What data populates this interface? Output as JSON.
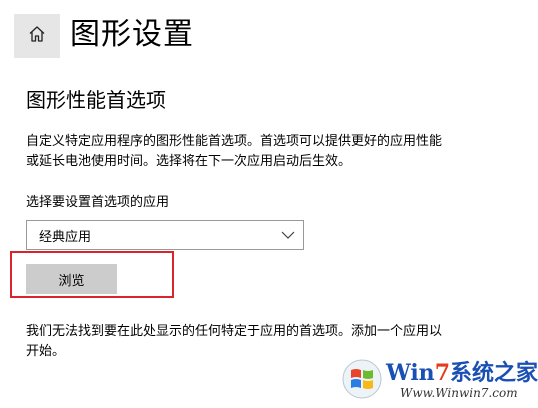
{
  "header": {
    "title": "图形设置",
    "home_icon": "home-icon"
  },
  "section": {
    "title": "图形性能首选项",
    "description_line1": "自定义特定应用程序的图形性能首选项。首选项可以提供更好的应用性能",
    "description_line2": "或延长电池使用时间。选择将在下一次应用启动后生效。"
  },
  "app_select": {
    "label": "选择要设置首选项的应用",
    "value": "经典应用",
    "icon": "chevron-down-icon"
  },
  "browse_button": {
    "label": "浏览"
  },
  "notice": {
    "line1": "我们无法找到要在此处显示的任何特定于应用的首选项。添加一个应用以",
    "line2": "开始。"
  },
  "watermark": {
    "brand_w": "Win",
    "brand_7": "7",
    "brand_cn": "系统之家",
    "url": "Www.Winwin7.com"
  },
  "colors": {
    "highlight": "#d9232d",
    "button_bg": "#cccccc",
    "home_bg": "#e6e6e6"
  }
}
